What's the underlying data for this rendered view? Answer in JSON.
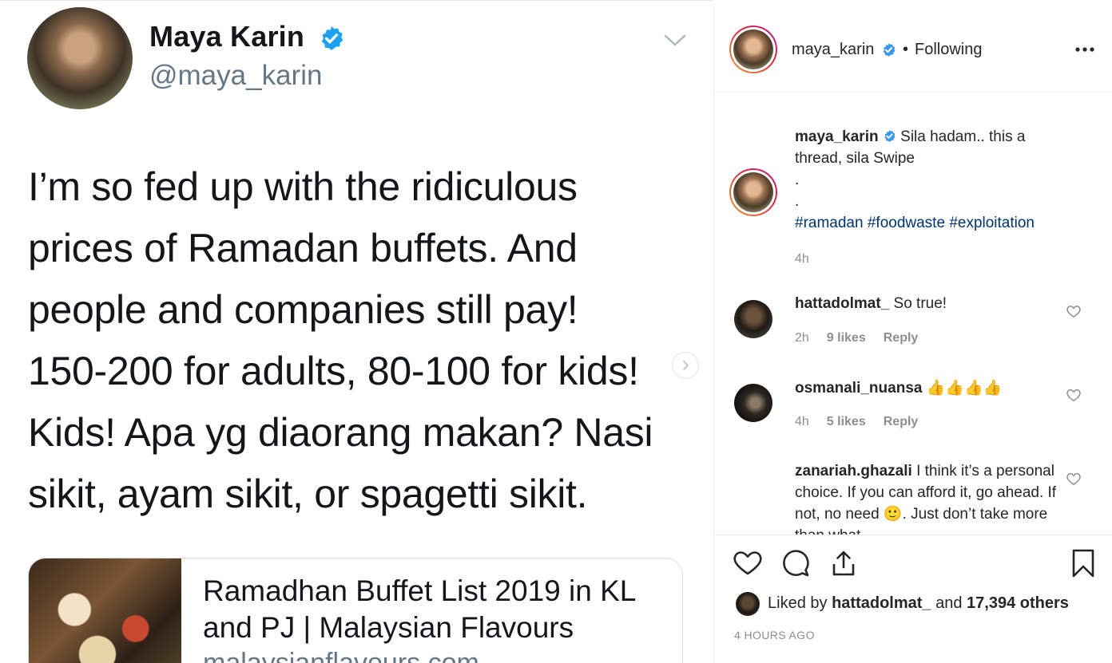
{
  "tweet": {
    "name": "Maya Karin",
    "handle": "@maya_karin",
    "text": "I’m so fed up with the ridiculous\nprices of Ramadan buffets. And\npeople and companies still pay!\n150-200 for adults, 80-100 for kids!\nKids! Apa yg diaorang makan? Nasi\nsikit, ayam sikit, or spagetti sikit.",
    "link_card": {
      "title": "Ramadhan Buffet List 2019 in KL and PJ | Malaysian Flavours",
      "domain": "malaysianflavours.com"
    }
  },
  "post": {
    "username": "maya_karin",
    "separator": "•",
    "follow_status": "Following",
    "caption": {
      "username": "maya_karin",
      "text": "Sila hadam.. this a thread, sila Swipe",
      "line2": ".",
      "line3": ".",
      "hashtags": [
        "#ramadan",
        "#foodwaste",
        "#exploitation"
      ],
      "age": "4h"
    },
    "comments": [
      {
        "username": "hattadolmat_",
        "text": "So true!",
        "age": "2h",
        "likes": "9 likes",
        "reply": "Reply"
      },
      {
        "username": "osmanali_nuansa",
        "text": "👍👍👍👍",
        "age": "4h",
        "likes": "5 likes",
        "reply": "Reply"
      },
      {
        "username": "zanariah.ghazali",
        "text": "I think it’s a personal choice. If you can afford it, go ahead. If not, no need 🙂. Just don’t take more than what"
      }
    ],
    "liked_by": {
      "prefix": "Liked by",
      "user": "hattadolmat_",
      "and": "and",
      "others": "17,394 others"
    },
    "timestamp": "4 HOURS AGO"
  },
  "colors": {
    "accent": "#3897f0",
    "verified": "#3897f0",
    "hashtag": "#003569",
    "muted": "#8e8e8e",
    "tweet_text": "#14171a",
    "tweet_muted": "#657786"
  },
  "icons": [
    "verified-badge-icon",
    "chevron-down-icon",
    "chevron-right-icon",
    "more-options-icon",
    "heart-icon",
    "comment-icon",
    "share-icon",
    "bookmark-icon"
  ]
}
